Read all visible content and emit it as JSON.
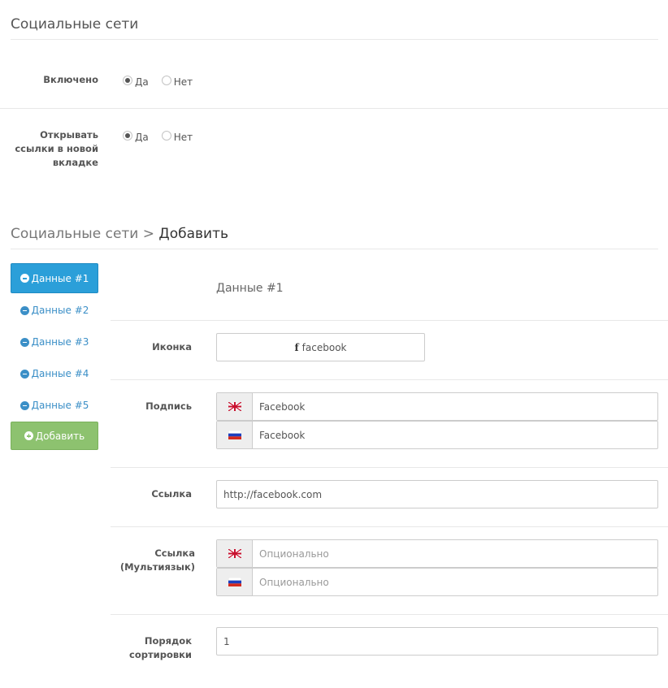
{
  "section1": {
    "title": "Социальные сети",
    "enabled": {
      "label": "Включено",
      "options": [
        "Да",
        "Нет"
      ],
      "selected": "Да"
    },
    "new_tab": {
      "label_lines": [
        "Открывать",
        "ссылки в новой",
        "вкладке"
      ],
      "options": [
        "Да",
        "Нет"
      ],
      "selected": "Да"
    }
  },
  "section2": {
    "title_prefix": "Социальные сети",
    "separator": ">",
    "title_suffix": "Добавить"
  },
  "nav": {
    "items": [
      "Данные #1",
      "Данные #2",
      "Данные #3",
      "Данные #4",
      "Данные #5"
    ],
    "active": "Данные #1",
    "add_label": "Добавить"
  },
  "form": {
    "heading": "Данные #1",
    "icon": {
      "label": "Иконка",
      "value": "facebook",
      "glyph": "f",
      "icon_name": "facebook-icon"
    },
    "caption": {
      "label": "Подпись",
      "values": [
        {
          "lang": "en",
          "flag": "uk-flag-icon",
          "value": "Facebook"
        },
        {
          "lang": "ru",
          "flag": "russia-flag-icon",
          "value": "Facebook"
        }
      ]
    },
    "link": {
      "label": "Ссылка",
      "value": "http://facebook.com"
    },
    "link_ml": {
      "label_lines": [
        "Ссылка",
        "(Мультиязык)"
      ],
      "values": [
        {
          "lang": "en",
          "flag": "uk-flag-icon",
          "placeholder": "Опционально"
        },
        {
          "lang": "ru",
          "flag": "russia-flag-icon",
          "placeholder": "Опционально"
        }
      ]
    },
    "sort": {
      "label_lines": [
        "Порядок",
        "сортировки"
      ],
      "value": "1"
    }
  },
  "colors": {
    "primary": "#2b9fd9",
    "success": "#8dc26f",
    "link": "#3b8fc7"
  }
}
